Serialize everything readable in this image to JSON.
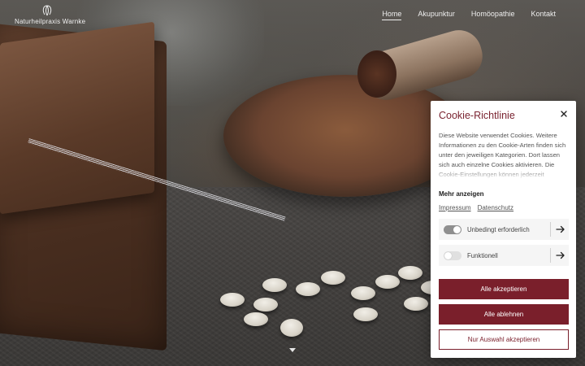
{
  "header": {
    "brand_name": "Naturheilpraxis Warnke",
    "nav": [
      {
        "label": "Home",
        "active": true
      },
      {
        "label": "Akupunktur",
        "active": false
      },
      {
        "label": "Homöopathie",
        "active": false
      },
      {
        "label": "Kontakt",
        "active": false
      }
    ]
  },
  "cookie": {
    "title": "Cookie-Richtlinie",
    "text": "Diese Website verwendet Cookies. Weitere Informationen zu den Cookie-Arten finden sich unter den jeweiligen Kategorien. Dort lassen sich auch einzelne Cookies aktivieren. Die Cookie-Einstellungen können jederzeit",
    "more_label": "Mehr anzeigen",
    "links": {
      "impressum": "Impressum",
      "datenschutz": "Datenschutz"
    },
    "categories": [
      {
        "label": "Unbedingt erforderlich",
        "enabled": true
      },
      {
        "label": "Funktionell",
        "enabled": false
      }
    ],
    "buttons": {
      "accept_all": "Alle akzeptieren",
      "reject_all": "Alle ablehnen",
      "accept_selection": "Nur Auswahl akzeptieren"
    }
  },
  "colors": {
    "accent": "#7a1f2b",
    "toggle_on": "#8f8f8f",
    "toggle_off": "#e0e0e0"
  },
  "icons": [
    "brand-logo-icon",
    "close-icon",
    "arrow-right-icon",
    "scroll-down-icon"
  ]
}
